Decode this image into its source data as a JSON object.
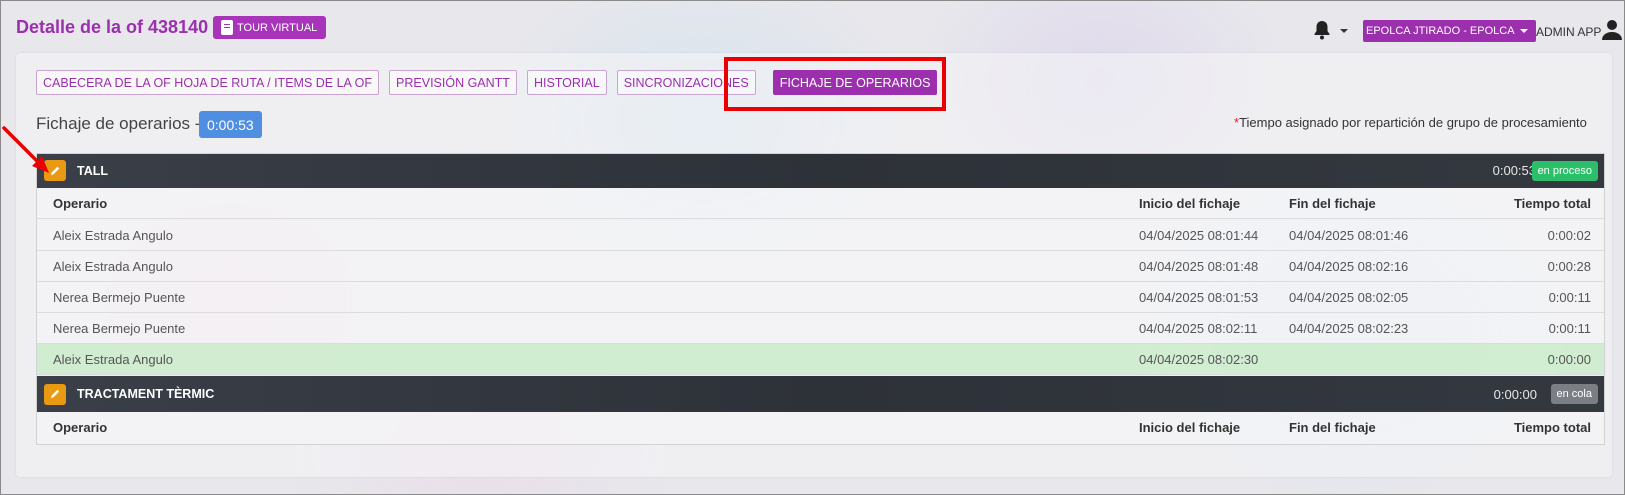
{
  "header": {
    "title": "Detalle de la of 438140",
    "tour_label": "TOUR VIRTUAL",
    "company_label": "EPOLCA JTIRADO - EPOLCA",
    "user_label": "ADMIN APP",
    "icons": [
      "book-icon",
      "bell-icon",
      "user-icon"
    ]
  },
  "tabs": [
    {
      "label": "CABECERA DE LA OF HOJA DE RUTA / ITEMS DE LA OF"
    },
    {
      "label": "PREVISIÓN GANTT"
    },
    {
      "label": "HISTORIAL"
    },
    {
      "label": "SINCRONIZACIONES"
    },
    {
      "label": "FICHAJE DE OPERARIOS",
      "active": true
    }
  ],
  "section": {
    "title": "Fichaje de operarios -",
    "total": "0:00:53",
    "note_asterisk": "*",
    "note": "Tiempo asignado por repartición de grupo de procesamiento"
  },
  "columns": {
    "operario": "Operario",
    "inicio": "Inicio del fichaje",
    "fin": "Fin del fichaje",
    "total": "Tiempo total"
  },
  "groups": [
    {
      "name": "TALL",
      "time": "0:00:53",
      "status": "en proceso",
      "status_color": "#2bbf6a",
      "rows": [
        {
          "operario": "Aleix Estrada Angulo",
          "inicio": "04/04/2025 08:01:44",
          "fin": "04/04/2025 08:01:46",
          "total": "0:00:02"
        },
        {
          "operario": "Aleix Estrada Angulo",
          "inicio": "04/04/2025 08:01:48",
          "fin": "04/04/2025 08:02:16",
          "total": "0:00:28"
        },
        {
          "operario": "Nerea Bermejo Puente",
          "inicio": "04/04/2025 08:01:53",
          "fin": "04/04/2025 08:02:05",
          "total": "0:00:11"
        },
        {
          "operario": "Nerea Bermejo Puente",
          "inicio": "04/04/2025 08:02:11",
          "fin": "04/04/2025 08:02:23",
          "total": "0:00:11"
        },
        {
          "operario": "Aleix Estrada Angulo",
          "inicio": "04/04/2025 08:02:30",
          "fin": "",
          "total": "0:00:00",
          "in_progress": true
        }
      ]
    },
    {
      "name": "TRACTAMENT TÈRMIC",
      "time": "0:00:00",
      "status": "en cola",
      "status_color": "#7b7f85",
      "rows": []
    }
  ],
  "colors": {
    "brand": "#9c2fae",
    "accent": "#4f8ee0",
    "edit": "#e89a12",
    "annotation": "#ea0000"
  }
}
